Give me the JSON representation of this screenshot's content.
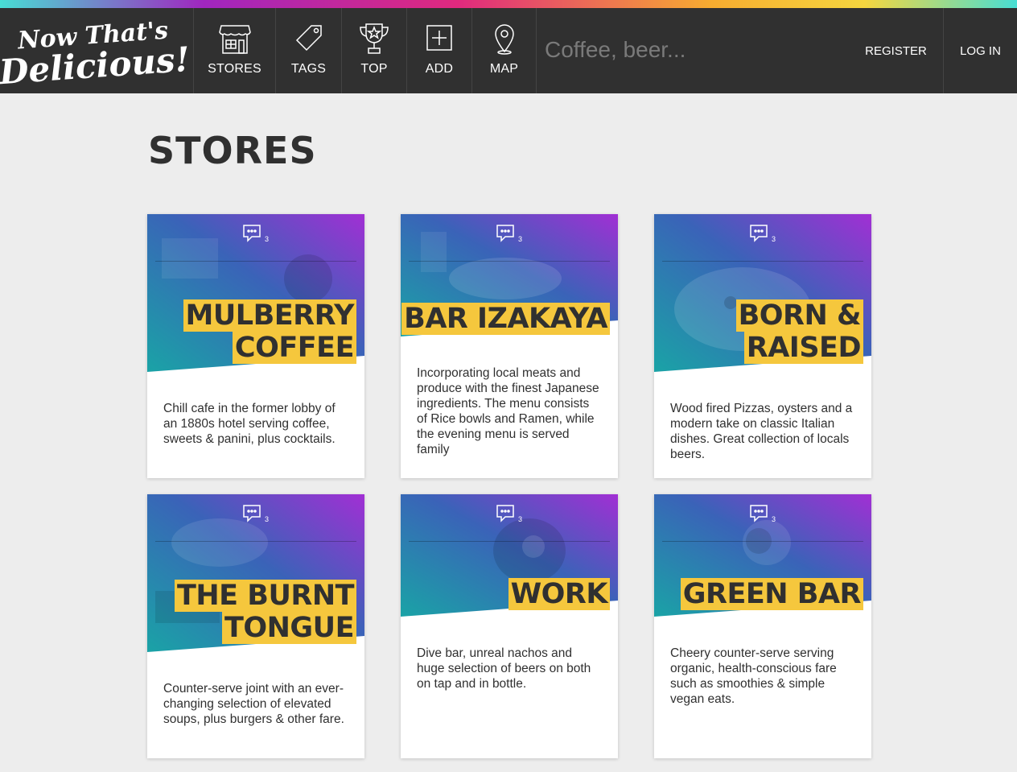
{
  "brand": {
    "logo_line1": "Now That's",
    "logo_line2": "Delicious!"
  },
  "nav": {
    "items": [
      {
        "label": "STORES",
        "icon": "store-icon"
      },
      {
        "label": "TAGS",
        "icon": "tag-icon"
      },
      {
        "label": "TOP",
        "icon": "trophy-icon"
      },
      {
        "label": "ADD",
        "icon": "add-icon"
      },
      {
        "label": "MAP",
        "icon": "map-pin-icon"
      }
    ],
    "search_placeholder": "Coffee, beer...",
    "register_label": "REGISTER",
    "login_label": "LOG IN"
  },
  "page": {
    "title": "STORES"
  },
  "stores": [
    {
      "name": "MULBERRY COFFEE",
      "name_lines": [
        "MULBERRY",
        "COFFEE"
      ],
      "reviews": "3",
      "description": "Chill cafe in the former lobby of an 1880s hotel serving coffee, sweets & panini, plus cocktails."
    },
    {
      "name": "BAR IZAKAYA",
      "name_lines": [
        "BAR IZAKAYA"
      ],
      "reviews": "3",
      "description": "Incorporating local meats and produce with the finest Japanese ingredients. The menu consists of Rice bowls and Ramen, while the evening menu is served family"
    },
    {
      "name": "BORN & RAISED",
      "name_lines": [
        "BORN &",
        "RAISED"
      ],
      "reviews": "3",
      "description": "Wood fired Pizzas, oysters and a modern take on classic Italian dishes. Great collection of locals beers."
    },
    {
      "name": "THE BURNT TONGUE",
      "name_lines": [
        "THE BURNT",
        "TONGUE"
      ],
      "reviews": "3",
      "description": "Counter-serve joint with an ever-changing selection of elevated soups, plus burgers & other fare."
    },
    {
      "name": "WORK",
      "name_lines": [
        "WORK"
      ],
      "reviews": "3",
      "description": "Dive bar, unreal nachos and huge selection of beers on both on tap and in bottle."
    },
    {
      "name": "GREEN BAR",
      "name_lines": [
        "GREEN BAR"
      ],
      "reviews": "3",
      "description": "Cheery counter-serve serving organic, health-conscious fare such as smoothies & simple vegan eats."
    }
  ],
  "colors": {
    "nav_bg": "#303030",
    "accent_yellow": "#f5c73d",
    "gradient_teal": "#1fa3a8",
    "gradient_purple": "#9a2fd0",
    "page_bg": "#ededed"
  }
}
